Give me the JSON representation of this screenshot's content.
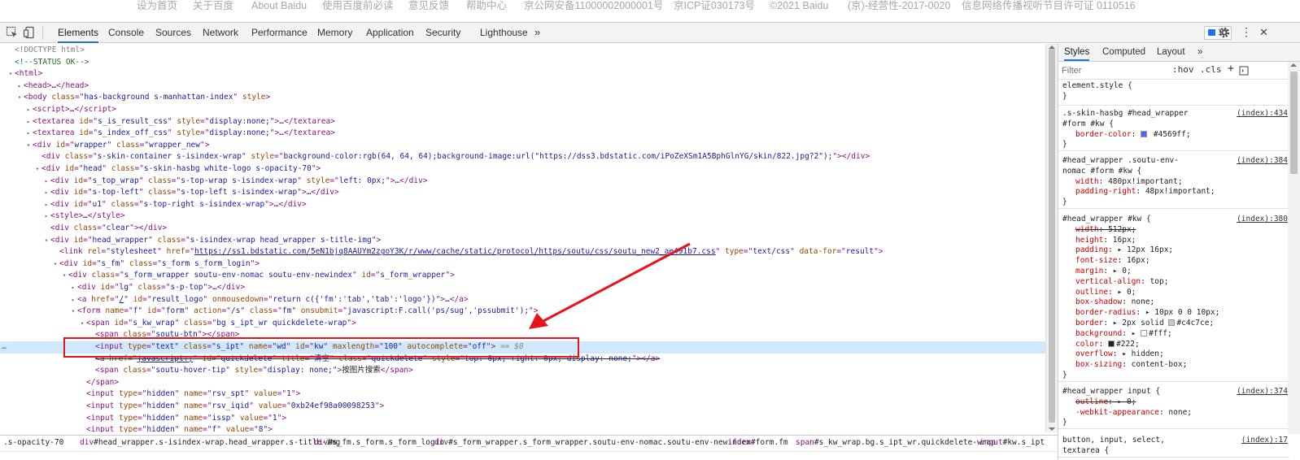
{
  "baidu_footer": {
    "links": [
      "设为首页",
      "关于百度",
      "About Baidu",
      "使用百度前必读",
      "意见反馈",
      "帮助中心",
      "京公网安备11000002000001号",
      "京ICP证030173号",
      "©2021 Baidu",
      "(京)-经营性-2017-0020",
      "信息网络传播视听节目许可证 0110516"
    ]
  },
  "devtools_toolbar": {
    "tabs": [
      "Elements",
      "Console",
      "Sources",
      "Network",
      "Performance",
      "Memory",
      "Application",
      "Security",
      "Lighthouse"
    ],
    "more": "»",
    "issues_count": "18",
    "kebab": "⋮",
    "close": "✕",
    "icons": [
      "inspect-icon",
      "device-toolbar-icon",
      "gear-icon",
      "more-menu-icon",
      "close-icon"
    ]
  },
  "elements_tree": {
    "lines": [
      {
        "html": "<span class='doct'>&lt;!DOCTYPE html&gt;</span>"
      },
      {
        "html": "<span class='cmt'>&lt;!--STATUS OK--&gt;</span>"
      },
      {
        "html": "<span class='tag'>&lt;html&gt;</span>"
      },
      {
        "html": "<span class='tag'>&lt;head&gt;</span>…<span class='tag'>&lt;/head&gt;</span>"
      },
      {
        "html": "<span class='tag'>&lt;body </span><span class='attr'>class</span><span class='tag'>=\"</span><span class='val'>has-background s-manhattan-index</span><span class='tag'>\" </span><span class='attr'>style</span><span class='tag'>&gt;</span>"
      },
      {
        "html": "<span class='tag'>&lt;script&gt;</span>…<span class='tag'>&lt;/script&gt;</span>"
      },
      {
        "html": "<span class='tag'>&lt;textarea </span><span class='attr'>id</span><span class='tag'>=\"</span><span class='val'>s_is_result_css</span><span class='tag'>\" </span><span class='attr'>style</span><span class='tag'>=\"</span><span class='val'>display:none;</span><span class='tag'>\"&gt;</span>…<span class='tag'>&lt;/textarea&gt;</span>"
      },
      {
        "html": "<span class='tag'>&lt;textarea </span><span class='attr'>id</span><span class='tag'>=\"</span><span class='val'>s_index_off_css</span><span class='tag'>\" </span><span class='attr'>style</span><span class='tag'>=\"</span><span class='val'>display:none;</span><span class='tag'>\"&gt;</span>…<span class='tag'>&lt;/textarea&gt;</span>"
      },
      {
        "html": "<span class='tag'>&lt;div </span><span class='attr'>id</span><span class='tag'>=\"</span><span class='val'>wrapper</span><span class='tag'>\" </span><span class='attr'>class</span><span class='tag'>=\"</span><span class='val'>wrapper_new</span><span class='tag'>\"&gt;</span>"
      },
      {
        "html": "<span class='tag'>&lt;div </span><span class='attr'>class</span><span class='tag'>=\"</span><span class='val'>s-skin-container s-isindex-wrap</span><span class='tag'>\" </span><span class='attr'>style</span><span class='tag'>=\"</span><span class='val'>background-color:rgb(64, 64, 64);background-image:url(\"https://dss3.bdstatic.com/iPoZeXSm1A5BphGlnYG/skin/822.jpg?2\");</span><span class='tag'>\"&gt;&lt;/div&gt;</span>"
      },
      {
        "html": "<span class='tag'>&lt;div </span><span class='attr'>id</span><span class='tag'>=\"</span><span class='val'>head</span><span class='tag'>\" </span><span class='attr'>class</span><span class='tag'>=\"</span><span class='val'>s-skin-hasbg white-logo s-opacity-70</span><span class='tag'>\"&gt;</span>"
      },
      {
        "html": "<span class='tag'>&lt;div </span><span class='attr'>id</span><span class='tag'>=\"</span><span class='val'>s_top_wrap</span><span class='tag'>\" </span><span class='attr'>class</span><span class='tag'>=\"</span><span class='val'>s-top-wrap s-isindex-wrap</span><span class='tag'>\" </span><span class='attr'>style</span><span class='tag'>=\"</span><span class='val'>left: 0px;</span><span class='tag'>\"&gt;</span>…<span class='tag'>&lt;/div&gt;</span>"
      },
      {
        "html": "<span class='tag'>&lt;div </span><span class='attr'>id</span><span class='tag'>=\"</span><span class='val'>s-top-left</span><span class='tag'>\" </span><span class='attr'>class</span><span class='tag'>=\"</span><span class='val'>s-top-left s-isindex-wrap</span><span class='tag'>\"&gt;</span>…<span class='tag'>&lt;/div&gt;</span>"
      },
      {
        "html": "<span class='tag'>&lt;div </span><span class='attr'>id</span><span class='tag'>=\"</span><span class='val'>u1</span><span class='tag'>\" </span><span class='attr'>class</span><span class='tag'>=\"</span><span class='val'>s-top-right s-isindex-wrap</span><span class='tag'>\"&gt;</span>…<span class='tag'>&lt;/div&gt;</span>"
      },
      {
        "html": "<span class='tag'>&lt;style&gt;</span>…<span class='tag'>&lt;/style&gt;</span>"
      },
      {
        "html": "<span class='tag'>&lt;div </span><span class='attr'>class</span><span class='tag'>=\"</span><span class='val'>clear</span><span class='tag'>\"&gt;&lt;/div&gt;</span>"
      },
      {
        "html": "<span class='tag'>&lt;div </span><span class='attr'>id</span><span class='tag'>=\"</span><span class='val'>head_wrapper</span><span class='tag'>\" </span><span class='attr'>class</span><span class='tag'>=\"</span><span class='val'>s-isindex-wrap head_wrapper s-title-img</span><span class='tag'>\"&gt;</span>"
      },
      {
        "html": "<span class='tag'>&lt;link </span><span class='attr'>rel</span><span class='tag'>=\"</span><span class='val'>stylesheet</span><span class='tag'>\" </span><span class='attr'>href</span><span class='tag'>=\"</span><span class='link'>https://ss1.bdstatic.com/5eN1bjq8AAUYm2zgoY3K/r/www/cache/static/protocol/https/soutu/css/soutu_new2_ae491b7.css</span><span class='tag'>\" </span><span class='attr'>type</span><span class='tag'>=\"</span><span class='val'>text/css</span><span class='tag'>\" </span><span class='attr'>data-for</span><span class='tag'>=\"</span><span class='val'>result</span><span class='tag'>\"&gt;</span>"
      },
      {
        "html": "<span class='tag'>&lt;div </span><span class='attr'>id</span><span class='tag'>=\"</span><span class='val'>s_fm</span><span class='tag'>\" </span><span class='attr'>class</span><span class='tag'>=\"</span><span class='val'>s_form s_form_login</span><span class='tag'>\"&gt;</span>"
      },
      {
        "html": "<span class='tag'>&lt;div </span><span class='attr'>class</span><span class='tag'>=\"</span><span class='val'>s_form_wrapper soutu-env-nomac soutu-env-newindex</span><span class='tag'>\" </span><span class='attr'>id</span><span class='tag'>=\"</span><span class='val'>s_form_wrapper</span><span class='tag'>\"&gt;</span>"
      },
      {
        "html": "<span class='tag'>&lt;div </span><span class='attr'>id</span><span class='tag'>=\"</span><span class='val'>lg</span><span class='tag'>\" </span><span class='attr'>class</span><span class='tag'>=\"</span><span class='val'>s-p-top</span><span class='tag'>\"&gt;</span>…<span class='tag'>&lt;/div&gt;</span>"
      },
      {
        "html": "<span class='tag'>&lt;a </span><span class='attr'>href</span><span class='tag'>=\"</span><span class='link'>/</span><span class='tag'>\" </span><span class='attr'>id</span><span class='tag'>=\"</span><span class='val'>result_logo</span><span class='tag'>\" </span><span class='attr'>onmousedown</span><span class='tag'>=\"</span><span class='val'>return c({'fm':'tab','tab':'logo'})</span><span class='tag'>\"&gt;</span>…<span class='tag'>&lt;/a&gt;</span>"
      },
      {
        "html": "<span class='tag'>&lt;form </span><span class='attr'>name</span><span class='tag'>=\"</span><span class='val'>f</span><span class='tag'>\" </span><span class='attr'>id</span><span class='tag'>=\"</span><span class='val'>form</span><span class='tag'>\" </span><span class='attr'>action</span><span class='tag'>=\"</span><span class='val'>/s</span><span class='tag'>\" </span><span class='attr'>class</span><span class='tag'>=\"</span><span class='val'>fm</span><span class='tag'>\" </span><span class='attr'>onsubmit</span><span class='tag'>=\"</span><span class='val'>javascript:F.call('ps/sug','pssubmit');</span><span class='tag'>\"&gt;</span>"
      },
      {
        "html": "<span class='tag'>&lt;span </span><span class='attr'>id</span><span class='tag'>=\"</span><span class='val'>s_kw_wrap</span><span class='tag'>\" </span><span class='attr'>class</span><span class='tag'>=\"</span><span class='val'>bg s_ipt_wr quickdelete-wrap</span><span class='tag'>\"&gt;</span>"
      },
      {
        "html": "<span class='tag'>&lt;span </span><span class='attr'>class</span><span class='tag'>=\"</span><span class='val'>soutu-btn</span><span class='tag'>\"&gt;&lt;/span&gt;</span>"
      },
      {
        "html": "<span class='tag'>&lt;input </span><span class='attr'>type</span><span class='tag'>=\"</span><span class='val'>text</span><span class='tag'>\" </span><span class='attr'>class</span><span class='tag'>=\"</span><span class='val'>s_ipt</span><span class='tag'>\" </span><span class='attr'>name</span><span class='tag'>=\"</span><span class='val'>wd</span><span class='tag'>\" </span><span class='attr'>id</span><span class='tag'>=\"</span><span class='val'>kw</span><span class='tag'>\" </span><span class='attr'>maxlength</span><span class='tag'>=\"</span><span class='val'>100</span><span class='tag'>\" </span><span class='attr'>autocomplete</span><span class='tag'>=\"</span><span class='val'>off</span><span class='tag'>\"&gt;</span> <span class='eq'>== $0</span>"
      },
      {
        "html": "<span class='tag'>&lt;a </span><span class='attr'>href</span><span class='tag'>=\"</span><span class='link'>javascript:;</span><span class='tag'>\" </span><span class='attr'>id</span><span class='tag'>=\"</span><span class='val'>quickdelete</span><span class='tag'>\" </span><span class='attr'>title</span><span class='tag'>=\"</span><span class='val'>清空</span><span class='tag'>\" </span><span class='attr'>class</span><span class='tag'>=\"</span><span class='val'>quickdelete</span><span class='tag'>\" </span><span class='attr'>style</span><span class='tag'>=\"</span><span class='val'>top: 0px; right: 0px; display: none;</span><span class='tag'>\"&gt;&lt;/a&gt;</span>"
      },
      {
        "html": "<span class='tag'>&lt;span </span><span class='attr'>class</span><span class='tag'>=\"</span><span class='val'>soutu-hover-tip</span><span class='tag'>\" </span><span class='attr'>style</span><span class='tag'>=\"</span><span class='val'>display: none;</span><span class='tag'>\"&gt;</span>按图片搜索<span class='tag'>&lt;/span&gt;</span>"
      },
      {
        "html": "<span class='tag'>&lt;/span&gt;</span>"
      },
      {
        "html": "<span class='tag'>&lt;input </span><span class='attr'>type</span><span class='tag'>=\"</span><span class='val'>hidden</span><span class='tag'>\" </span><span class='attr'>name</span><span class='tag'>=\"</span><span class='val'>rsv_spt</span><span class='tag'>\" </span><span class='attr'>value</span><span class='tag'>=\"</span><span class='val'>1</span><span class='tag'>\"&gt;</span>"
      },
      {
        "html": "<span class='tag'>&lt;input </span><span class='attr'>type</span><span class='tag'>=\"</span><span class='val'>hidden</span><span class='tag'>\" </span><span class='attr'>name</span><span class='tag'>=\"</span><span class='val'>rsv_iqid</span><span class='tag'>\" </span><span class='attr'>value</span><span class='tag'>=\"</span><span class='val'>0xb24ef98a00098253</span><span class='tag'>\"&gt;</span>"
      },
      {
        "html": "<span class='tag'>&lt;input </span><span class='attr'>type</span><span class='tag'>=\"</span><span class='val'>hidden</span><span class='tag'>\" </span><span class='attr'>name</span><span class='tag'>=\"</span><span class='val'>issp</span><span class='tag'>\" </span><span class='attr'>value</span><span class='tag'>=\"</span><span class='val'>1</span><span class='tag'>\"&gt;</span>"
      },
      {
        "html": "<span class='tag'>&lt;input </span><span class='attr'>type</span><span class='tag'>=\"</span><span class='val'>hidden</span><span class='tag'>\" </span><span class='attr'>name</span><span class='tag'>=\"</span><span class='val'>f</span><span class='tag'>\" </span><span class='attr'>value</span><span class='tag'>=\"</span><span class='val'>8</span><span class='tag'>\"&gt;</span>"
      }
    ],
    "selected_line_marker": "…"
  },
  "breadcrumbs": [
    {
      "tag": ".s-opacity-70",
      "rest": ""
    },
    {
      "tag": "div",
      "rest": "#head_wrapper.s-isindex-wrap.head_wrapper.s-title-img"
    },
    {
      "tag": "div",
      "rest": "#s_fm.s_form.s_form_login"
    },
    {
      "tag": "div",
      "rest": "#s_form_wrapper.s_form_wrapper.soutu-env-nomac.soutu-env-newindex"
    },
    {
      "tag": "form",
      "rest": "#form.fm"
    },
    {
      "tag": "span",
      "rest": "#s_kw_wrap.bg.s_ipt_wr.quickdelete-wrap"
    },
    {
      "tag": "input",
      "rest": "#kw.s_ipt"
    }
  ],
  "styles_pane": {
    "tabs": [
      "Styles",
      "Computed",
      "Layout",
      "»"
    ],
    "filter_placeholder": "Filter",
    "hov": ":hov",
    "cls": ".cls",
    "plus": "+",
    "rules": [
      {
        "selector": "element.style {",
        "source": "",
        "decls": []
      },
      {
        "selector": ".s-skin-hasbg #head_wrapper\n#form #kw {",
        "source": "(index):434",
        "decls": [
          {
            "name": "border-color",
            "value": "#4569ff;",
            "swatch": "#4569ff",
            "strike": false
          }
        ]
      },
      {
        "selector": "#head_wrapper .soutu-env-\nnomac #form #kw {",
        "source": "(index):384",
        "decls": [
          {
            "name": "width",
            "value": "480px!important;",
            "strike": false
          },
          {
            "name": "padding-right",
            "value": "48px!important;",
            "strike": false
          }
        ]
      },
      {
        "selector": "#head_wrapper #kw {",
        "source": "(index):380",
        "decls": [
          {
            "name": "width",
            "value": "512px;",
            "strike": true
          },
          {
            "name": "height",
            "value": "16px;",
            "strike": false
          },
          {
            "name": "padding",
            "value": "▸ 12px 16px;",
            "strike": false
          },
          {
            "name": "font-size",
            "value": "16px;",
            "strike": false
          },
          {
            "name": "margin",
            "value": "▸ 0;",
            "strike": false
          },
          {
            "name": "vertical-align",
            "value": "top;",
            "strike": false
          },
          {
            "name": "outline",
            "value": "▸ 0;",
            "strike": false
          },
          {
            "name": "box-shadow",
            "value": "none;",
            "strike": false
          },
          {
            "name": "border-radius",
            "value": "▸ 10px 0 0 10px;",
            "strike": false
          },
          {
            "name": "border",
            "value": "▸ 2px solid ",
            "swatch": "#c4c7ce",
            "value2": "#c4c7ce;",
            "strike": false
          },
          {
            "name": "background",
            "value": "▸ ",
            "swatch": "#ffffff",
            "value2": "#fff;",
            "strike": false
          },
          {
            "name": "color",
            "value": "",
            "swatch": "#222222",
            "value2": "#222;",
            "strike": false
          },
          {
            "name": "overflow",
            "value": "▸ hidden;",
            "strike": false
          },
          {
            "name": "box-sizing",
            "value": "content-box;",
            "strike": false
          }
        ]
      },
      {
        "selector": "#head_wrapper input {",
        "source": "(index):374",
        "decls": [
          {
            "name": "outline",
            "value": "▸ 0;",
            "strike": true
          },
          {
            "name": "-webkit-appearance",
            "value": "none;",
            "strike": false
          }
        ]
      },
      {
        "selector": "button, input, select,\ntextarea {",
        "source": "(index):17",
        "decls": []
      }
    ],
    "close_brace": "}"
  },
  "colors": {
    "selected_row": "#cfe8fc",
    "annotation_red": "#e8121a",
    "active_tab": "#1a73e8"
  }
}
